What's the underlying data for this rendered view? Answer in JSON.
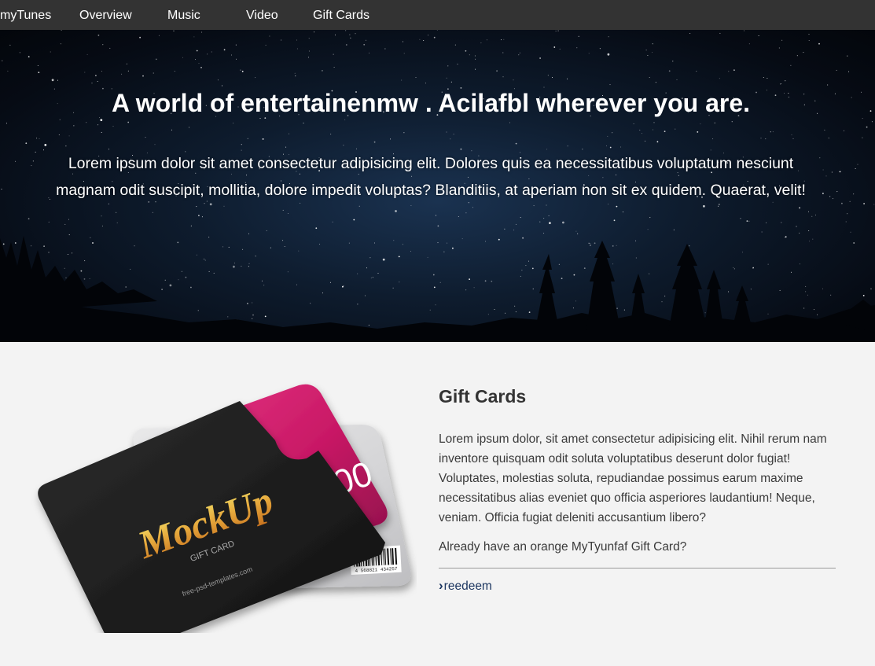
{
  "nav": {
    "brand": "myTunes",
    "items": [
      "Overview",
      "Music",
      "Video",
      "Gift Cards"
    ]
  },
  "hero": {
    "title": "A world of entertainenmw . Acilafbl wherever you are.",
    "text_line1": "Lorem ipsum dolor sit amet consectetur adipisicing elit. Dolores quis ea necessitatibus voluptatum nesciunt",
    "text_line2": "magnam odit suscipit, mollitia, dolore impedit voluptas? Blanditiis, at aperiam non sit ex quidem. Quaerat, velit!"
  },
  "giftcards": {
    "heading": "Gift Cards",
    "description": "Lorem ipsum dolor, sit amet consectetur adipisicing elit. Nihil rerum nam inventore quisquam odit soluta voluptatibus deserunt dolor fugiat! Voluptates, molestias soluta, repudiandae possimus earum maxime necessitatibus alias eveniet quo officia asperiores laudantium! Neque, veniam. Officia fugiat deleniti accusantium libero?",
    "already": "Already have an orange MyTyunfaf Gift Card?",
    "redeem_icon": "chevron-right-icon",
    "redeem_label": "reedeem",
    "card_image": {
      "logo_text": "MockUp",
      "card_label": "GIFT CARD",
      "site_text": "free-psd-templates.com",
      "value_text": "00",
      "barcode_text": "4 568821 434257"
    }
  },
  "colors": {
    "nav_bg": "#333333",
    "page_bg": "#f3f3f3",
    "link": "#1c3660",
    "card_pink": "#d6206f"
  }
}
